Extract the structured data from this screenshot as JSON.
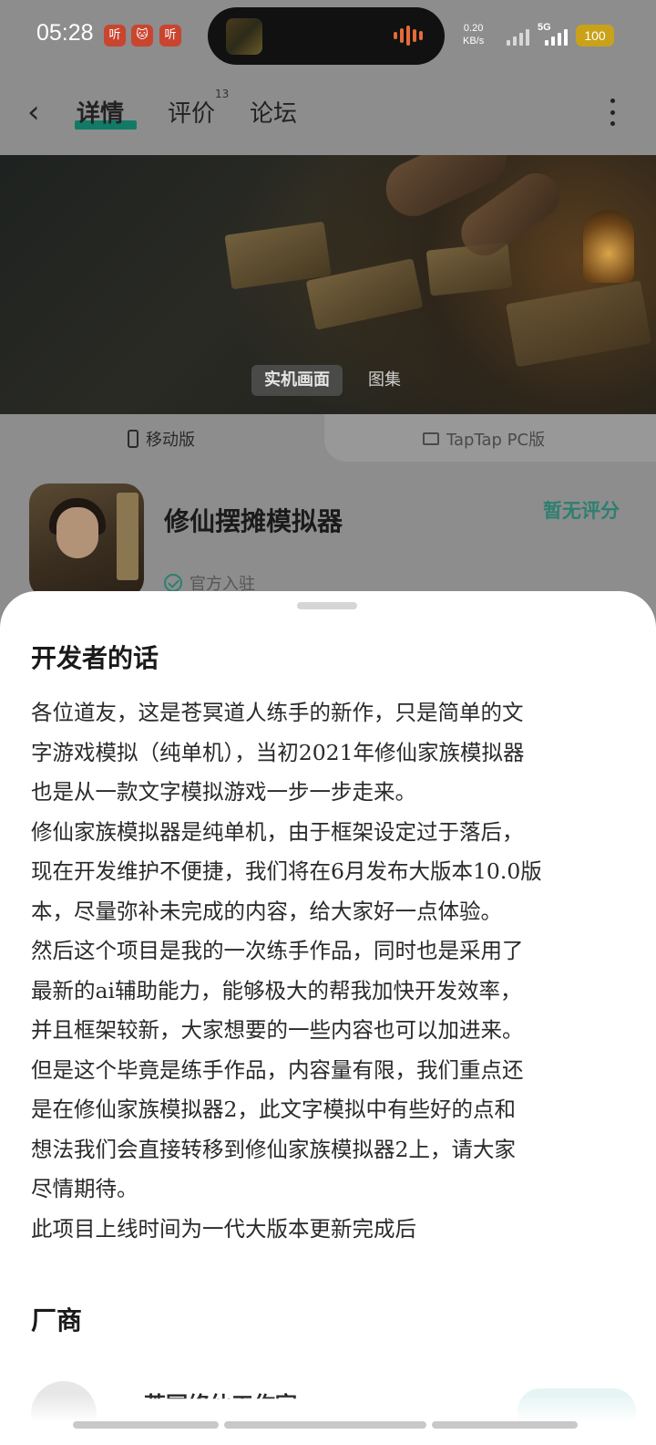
{
  "status_bar": {
    "time": "05:28",
    "badges": [
      "听",
      "🐱",
      "听"
    ],
    "net_speed": "0.20",
    "net_unit": "KB/s",
    "network": "5G",
    "battery": "100"
  },
  "nav": {
    "tabs": [
      {
        "label": "详情"
      },
      {
        "label": "评价",
        "count": "13"
      },
      {
        "label": "论坛"
      }
    ]
  },
  "media": {
    "tabs": [
      "实机画面",
      "图集"
    ]
  },
  "platforms": {
    "mobile": "移动版",
    "pc": "TapTap PC版"
  },
  "app": {
    "name": "修仙摆摊模拟器",
    "rating": "暂无评分",
    "official": "官方入驻"
  },
  "developer_notes": {
    "title": "开发者的话",
    "lines": [
      "各位道友，这是苍冥道人练手的新作，只是简单的文",
      "字游戏模拟（纯单机），当初2021年修仙家族模拟器",
      "也是从一款文字模拟游戏一步一步走来。",
      "修仙家族模拟器是纯单机，由于框架设定过于落后，",
      "现在开发维护不便捷，我们将在6月发布大版本10.0版",
      "本，尽量弥补未完成的内容，给大家好一点体验。",
      "然后这个项目是我的一次练手作品，同时也是采用了",
      "最新的ai辅助能力，能够极大的帮我加快开发效率，",
      "并且框架较新，大家想要的一些内容也可以加进来。",
      "但是这个毕竟是练手作品，内容量有限，我们重点还",
      "是在修仙家族模拟器2，此文字模拟中有些好的点和",
      "想法我们会直接转移到修仙家族模拟器2上，请大家",
      "尽情期待。",
      "此项目上线时间为一代大版本更新完成后"
    ]
  },
  "vendor": {
    "title": "厂商",
    "name": "苍冥修仙工作室"
  },
  "colors": {
    "accent": "#2e7f70",
    "tab_underline": "#127a67",
    "battery": "#c9a21a",
    "overlay": "#8d8d8d"
  }
}
